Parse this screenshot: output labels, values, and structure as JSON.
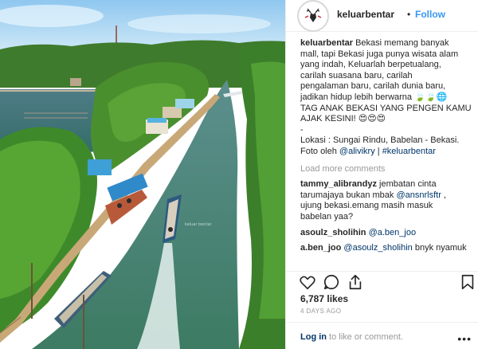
{
  "header": {
    "username": "keluarbentar",
    "separator": "•",
    "follow_label": "Follow"
  },
  "caption": {
    "username": "keluarbentar",
    "lines": [
      "Bekasi memang banyak",
      "mall, tapi Bekasi juga punya wisata alam",
      "yang indah, Keluarlah berpetualang,",
      "carilah suasana baru, carilah",
      "pengalaman baru, carilah dunia baru,",
      "jadikan hidup lebih berwarna 🍃🍃🌐",
      "TAG ANAK BEKASI YANG PENGEN KAMU",
      "AJAK KESINI! 😍😍😍",
      "-",
      "Lokasi : Sungai Rindu, Babelan - Bekasi.",
      "Foto oleh "
    ],
    "photo_credit_mention": "@alivikry",
    "separator": " | ",
    "hashtag": "#keluarbentar"
  },
  "load_more_label": "Load more comments",
  "comments": [
    {
      "username": "tammy_alibrandyz",
      "line1": " jembatan cinta",
      "line2a": "tarumajaya bukan mbak ",
      "mention": "@ansnrlsftr",
      "line2b": " ,",
      "line3": "ujung bekasi.emang masih masuk",
      "line4": "babelan yaa?"
    },
    {
      "username": "asoulz_sholihin",
      "mention": "@a.ben_joo"
    },
    {
      "username": "a.ben_joo",
      "mention": "@asoulz_sholihin",
      "text": " bnyk nyamuk"
    }
  ],
  "likes": "6,787 likes",
  "date": "4 DAYS AGO",
  "footer": {
    "login_link": "Log in",
    "login_text": " to like or comment.",
    "more": "•••"
  },
  "photo": {
    "watermark": "keluar bentar"
  },
  "colors": {
    "link": "#3897f0",
    "mention": "#003569",
    "muted": "#999999",
    "text": "#262626",
    "border": "#efefef"
  },
  "icons": [
    "heart-icon",
    "comment-icon",
    "share-icon",
    "bookmark-icon"
  ]
}
